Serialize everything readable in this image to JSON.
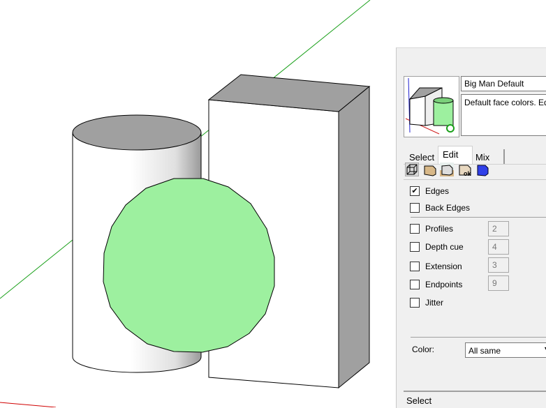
{
  "style_panel": {
    "style_name": "Big Man Default",
    "style_description": "Default face colors. Edges on",
    "tabs": [
      {
        "label": "Select"
      },
      {
        "label": "Edit",
        "active": true
      },
      {
        "label": "Mix"
      }
    ],
    "edit_icons": [
      "edge-settings-icon",
      "face-settings-icon",
      "background-settings-icon",
      "watermark-settings-icon",
      "modeling-settings-icon"
    ],
    "options": {
      "edges": {
        "label": "Edges",
        "checked": true
      },
      "back_edges": {
        "label": "Back Edges",
        "checked": false
      },
      "profiles": {
        "label": "Profiles",
        "checked": false,
        "value": "2"
      },
      "depth_cue": {
        "label": "Depth cue",
        "checked": false,
        "value": "4"
      },
      "extension": {
        "label": "Extension",
        "checked": false,
        "value": "3"
      },
      "endpoints": {
        "label": "Endpoints",
        "checked": false,
        "value": "9"
      },
      "jitter": {
        "label": "Jitter",
        "checked": false
      }
    },
    "color_label": "Color:",
    "color_value": "All same",
    "status": "Select"
  },
  "colors": {
    "green_face": "#9df09f",
    "gray_face": "#a0a0a0",
    "green_axis": "#00a000",
    "red_axis": "#d00000"
  }
}
